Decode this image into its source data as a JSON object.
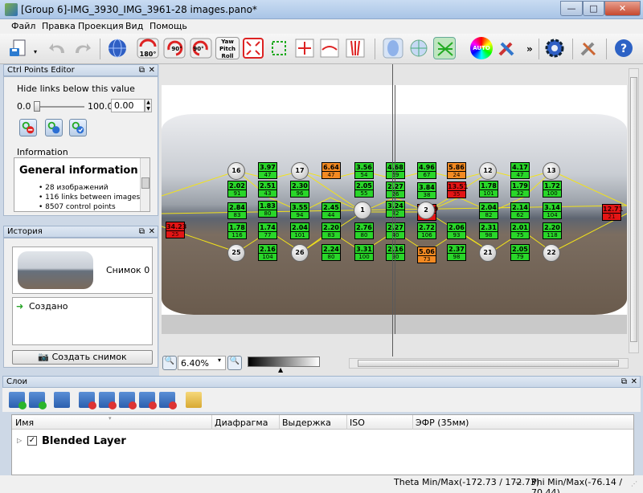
{
  "window": {
    "title": "[Group 6]-IMG_3930_IMG_3961-28 images.pano*",
    "min_label": "—",
    "max_label": "□",
    "close_label": "✕"
  },
  "menu": [
    "Файл",
    "Правка",
    "Проекция",
    "Вид",
    "Помощь"
  ],
  "toolbar": {
    "icons": [
      "new-icon",
      "save-icon",
      "undo-icon",
      "redo-icon",
      "globe-icon",
      "rotate-180-icon",
      "rotate-ccw-90-icon",
      "rotate-cw-90-icon",
      "yaw-pitch-roll-icon",
      "fit-frame-icon",
      "crop-icon",
      "straighten-icon",
      "horizon-icon",
      "vertical-lines-icon",
      "view-sphere-icon",
      "view-ortho-icon",
      "view-network-icon",
      "auto-color-icon",
      "tools-icon",
      "more-icon",
      "gear-icon",
      "wrench-icon",
      "help-icon"
    ],
    "rotate180_label": "180°",
    "rotate90a_label": "90°",
    "rotate90b_label": "90°",
    "ypr_label": "Yaw Pitch Roll",
    "auto_label": "AUTO",
    "more_label": "»"
  },
  "ctrl_points_editor": {
    "title": "Ctrl Points Editor",
    "hide_links_label": "Hide links below this value",
    "slider_min": "0.0",
    "slider_max": "100.0",
    "value": "0.00",
    "information_label": "Information",
    "general_info_title": "General information",
    "info_items": [
      "28 изображений",
      "116 links between images",
      "8507 control points"
    ]
  },
  "history": {
    "title": "История",
    "snapshot_label": "Снимок 0",
    "created_label": "Создано",
    "create_snapshot_button": "Создать снимок"
  },
  "zoom": {
    "value": "6.40%"
  },
  "layers": {
    "title": "Слои",
    "columns": [
      "Имя",
      "Диафрагма",
      "Выдержка",
      "ISO",
      "ЭФР (35мм)"
    ],
    "rows": [
      {
        "name": "Blended Layer",
        "checked": true
      }
    ]
  },
  "status": {
    "theta": "Theta Min/Max(-172.73 / 172.73)",
    "separator": "--",
    "phi": "Phi Min/Max(-76.14 / 70.44)"
  },
  "control_points": [
    {
      "value": "3.97",
      "count": "47",
      "color": "green"
    },
    {
      "value": "6.64",
      "count": "47",
      "color": "orange"
    },
    {
      "value": "3.56",
      "count": "54",
      "color": "green"
    },
    {
      "value": "4.68",
      "count": "69",
      "color": "green"
    },
    {
      "value": "4.96",
      "count": "67",
      "color": "green"
    },
    {
      "value": "5.86",
      "count": "24",
      "color": "orange"
    },
    {
      "value": "4.17",
      "count": "47",
      "color": "green"
    },
    {
      "value": "2.02",
      "count": "91",
      "color": "green"
    },
    {
      "value": "2.51",
      "count": "43",
      "color": "green"
    },
    {
      "value": "2.30",
      "count": "96",
      "color": "green"
    },
    {
      "value": "2.05",
      "count": "55",
      "color": "green"
    },
    {
      "value": "2.27",
      "count": "26",
      "color": "green"
    },
    {
      "value": "3.84",
      "count": "38",
      "color": "green"
    },
    {
      "value": "13.51",
      "count": "35",
      "color": "red"
    },
    {
      "value": "1.78",
      "count": "101",
      "color": "green"
    },
    {
      "value": "1.79",
      "count": "32",
      "color": "green"
    },
    {
      "value": "1.72",
      "count": "100",
      "color": "green"
    },
    {
      "value": "2.84",
      "count": "83",
      "color": "green"
    },
    {
      "value": "1.83",
      "count": "80",
      "color": "green"
    },
    {
      "value": "3.55",
      "count": "94",
      "color": "green"
    },
    {
      "value": "2.45",
      "count": "44",
      "color": "green"
    },
    {
      "value": "3.24",
      "count": "82",
      "color": "green"
    },
    {
      "value": "13.59",
      "count": "59",
      "color": "red"
    },
    {
      "value": "2.04",
      "count": "82",
      "color": "green"
    },
    {
      "value": "2.14",
      "count": "62",
      "color": "green"
    },
    {
      "value": "3.14",
      "count": "104",
      "color": "green"
    },
    {
      "value": "12.71",
      "count": "21",
      "color": "red"
    },
    {
      "value": "34.23",
      "count": "25",
      "color": "red"
    },
    {
      "value": "1.78",
      "count": "116",
      "color": "green"
    },
    {
      "value": "1.74",
      "count": "77",
      "color": "green"
    },
    {
      "value": "2.04",
      "count": "101",
      "color": "green"
    },
    {
      "value": "2.20",
      "count": "83",
      "color": "green"
    },
    {
      "value": "2.76",
      "count": "80",
      "color": "green"
    },
    {
      "value": "2.27",
      "count": "40",
      "color": "green"
    },
    {
      "value": "2.72",
      "count": "106",
      "color": "green"
    },
    {
      "value": "2.06",
      "count": "93",
      "color": "green"
    },
    {
      "value": "2.31",
      "count": "98",
      "color": "green"
    },
    {
      "value": "2.01",
      "count": "75",
      "color": "green"
    },
    {
      "value": "2.20",
      "count": "118",
      "color": "green"
    },
    {
      "value": "2.16",
      "count": "104",
      "color": "green"
    },
    {
      "value": "2.24",
      "count": "80",
      "color": "green"
    },
    {
      "value": "3.31",
      "count": "100",
      "color": "green"
    },
    {
      "value": "2.16",
      "count": "90",
      "color": "green"
    },
    {
      "value": "5.06",
      "count": "73",
      "color": "orange"
    },
    {
      "value": "2.37",
      "count": "98",
      "color": "green"
    },
    {
      "value": "2.05",
      "count": "79",
      "color": "green"
    }
  ],
  "image_markers": [
    "16",
    "17",
    "12",
    "13",
    "1",
    "2",
    "25",
    "26",
    "21",
    "22"
  ],
  "colors": {
    "green": "#29d629",
    "orange": "#f38a22",
    "red": "#e31515",
    "accent": "#2e6fb7"
  }
}
